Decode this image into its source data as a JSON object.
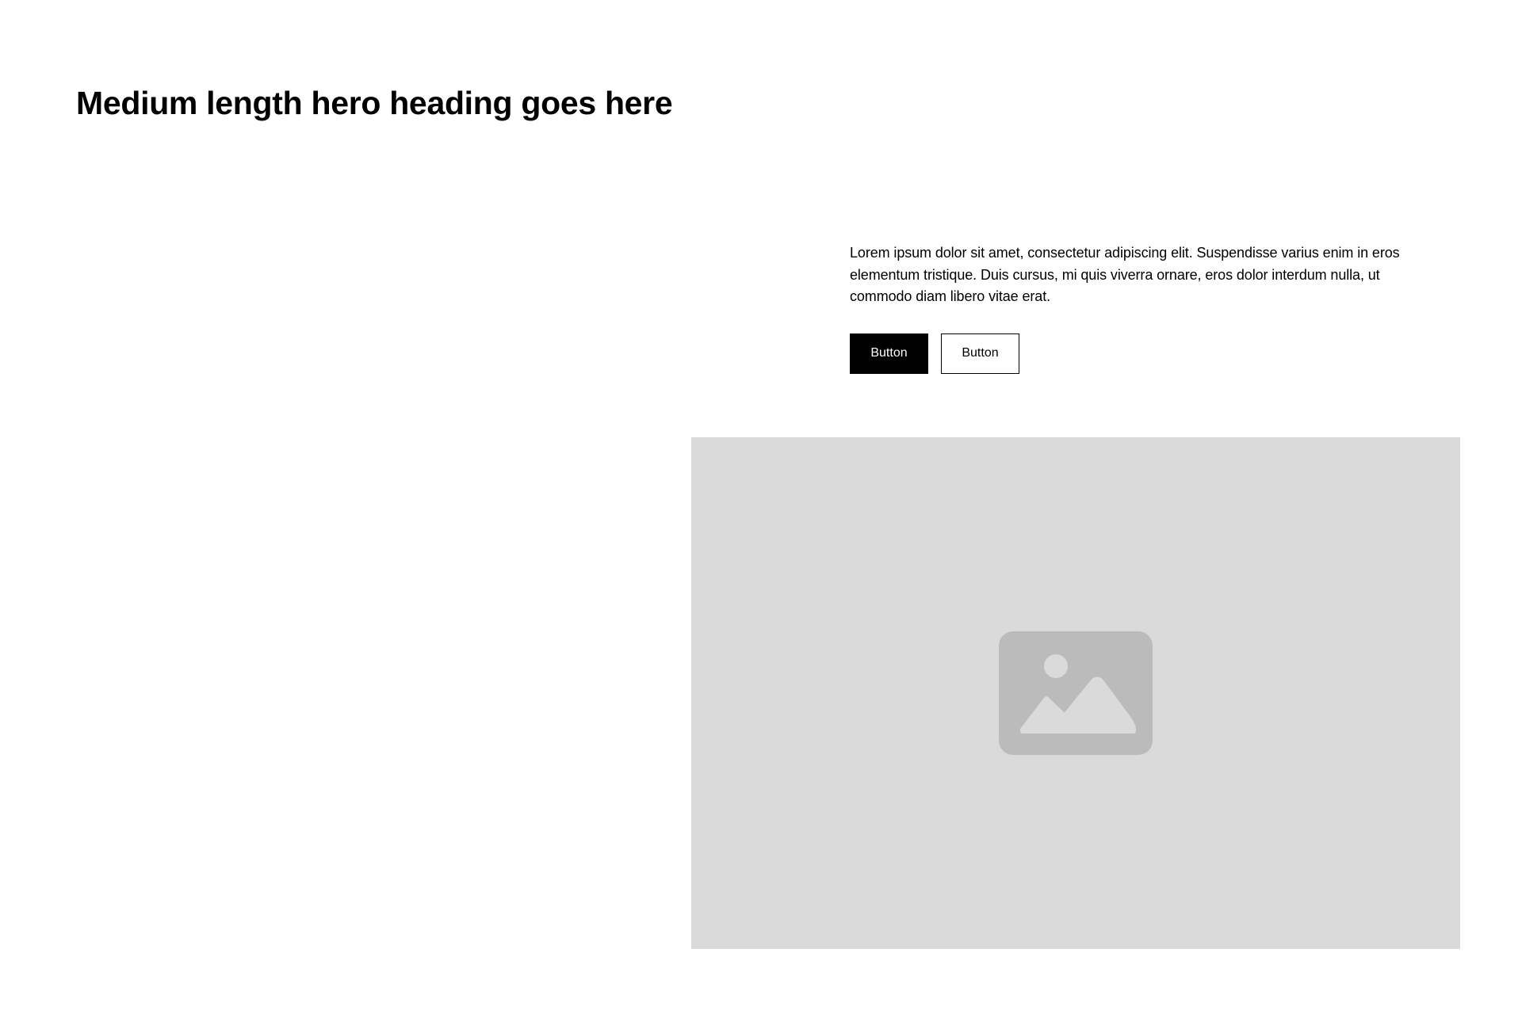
{
  "hero": {
    "heading": "Medium length hero heading goes here",
    "paragraph": "Lorem ipsum dolor sit amet, consectetur adipiscing elit. Suspendisse varius enim in eros elementum tristique. Duis cursus, mi quis viverra ornare, eros dolor interdum nulla, ut commodo diam libero vitae erat.",
    "primary_button_label": "Button",
    "secondary_button_label": "Button"
  },
  "image": {
    "icon": "image-placeholder-icon",
    "background_color": "#dadada",
    "icon_color": "#bbbbbb"
  },
  "colors": {
    "primary": "#000000",
    "background": "#ffffff"
  }
}
